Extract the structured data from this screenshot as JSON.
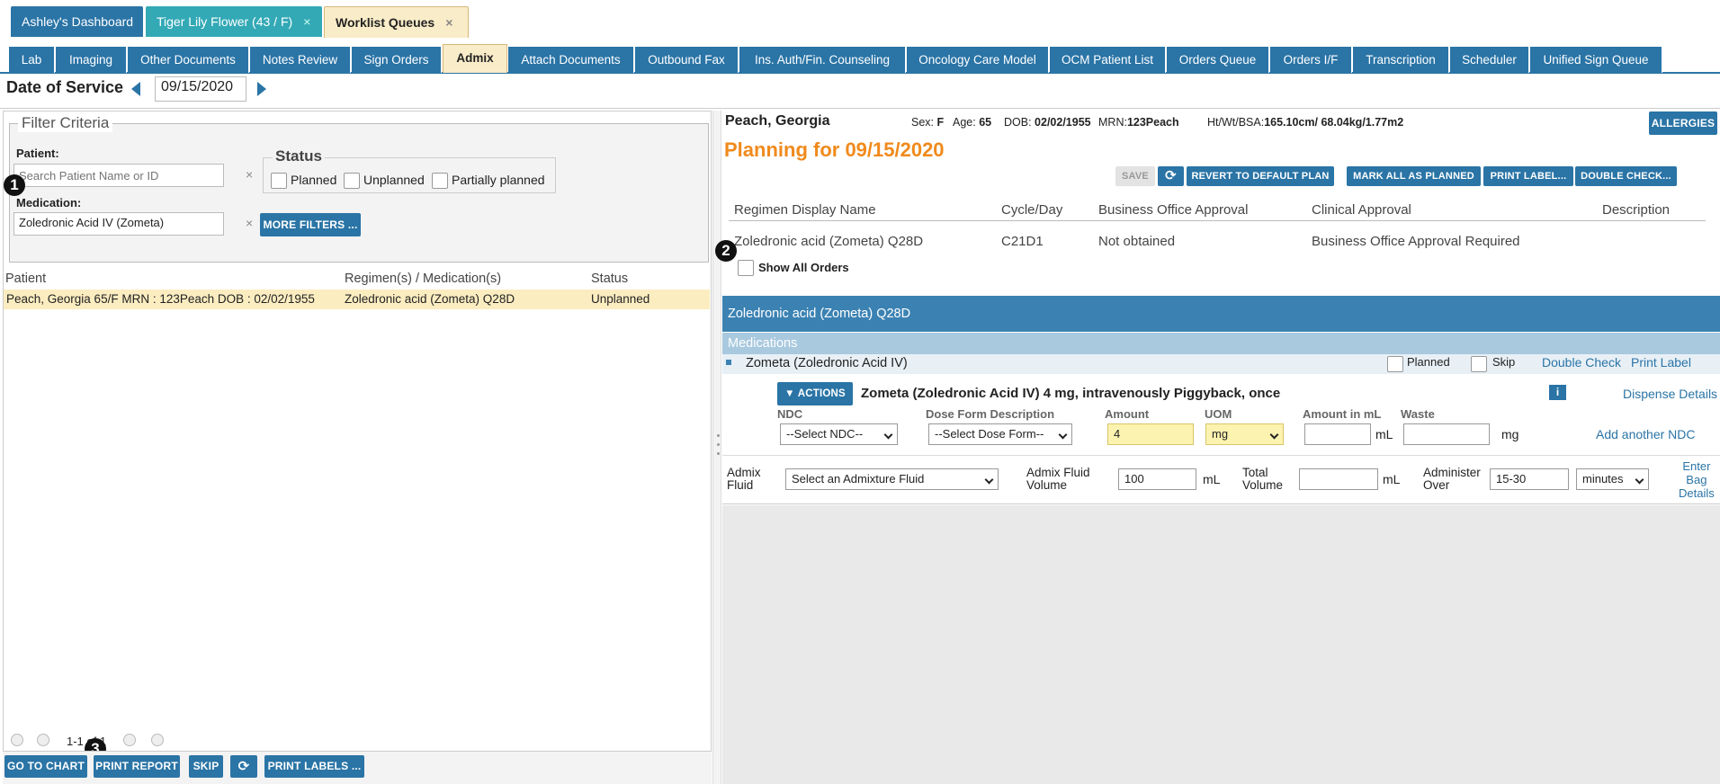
{
  "top_tabs": [
    {
      "label": "Ashley's Dashboard"
    },
    {
      "label": "Tiger Lily Flower (43 / F)",
      "close": "×"
    },
    {
      "label": "Worklist Queues",
      "close": "×"
    }
  ],
  "sub_tabs": [
    "Lab",
    "Imaging",
    "Other Documents",
    "Notes Review",
    "Sign Orders",
    "Admix",
    "Attach Documents",
    "Outbound Fax",
    "Ins. Auth/Fin. Counseling",
    "Oncology Care Model",
    "OCM Patient List",
    "Orders Queue",
    "Orders I/F",
    "Transcription",
    "Scheduler",
    "Unified Sign Queue"
  ],
  "date_of_service": {
    "label": "Date of Service",
    "value": "09/15/2020"
  },
  "filter": {
    "legend": "Filter Criteria",
    "patient_label": "Patient:",
    "patient_placeholder": "Search Patient Name or ID",
    "medication_label": "Medication:",
    "medication_value": "Zoledronic Acid IV (Zometa)",
    "clear": "×",
    "status_legend": "Status",
    "status_options": [
      "Planned",
      "Unplanned",
      "Partially planned"
    ],
    "more_filters": "MORE FILTERS ..."
  },
  "badges": [
    "1",
    "2",
    "3"
  ],
  "grid": {
    "headers": [
      "Patient",
      "Regimen(s) / Medication(s)",
      "Status"
    ],
    "rows": [
      {
        "patient": "Peach, Georgia 65/F MRN : 123Peach DOB : 02/02/1955",
        "regimen": "Zoledronic acid (Zometa) Q28D",
        "status": "Unplanned"
      }
    ],
    "pager": "1-1 of 1"
  },
  "bottom_buttons": [
    "GO TO CHART",
    "PRINT REPORT",
    "SKIP",
    "PRINT LABELS ..."
  ],
  "patient_header": {
    "name": "Peach, Georgia",
    "sex_label": "Sex:",
    "sex": "F",
    "age_label": "Age:",
    "age": "65",
    "dob_label": "DOB:",
    "dob": "02/02/1955",
    "mrn_label": "MRN:",
    "mrn": "123Peach",
    "hwbsa_label": "Ht/Wt/BSA:",
    "hwbsa": "165.10cm/ 68.04kg/1.77m2",
    "allergies": "ALLERGIES"
  },
  "planning_title": "Planning for 09/15/2020",
  "plan_buttons": {
    "save": "SAVE",
    "revert": "REVERT TO DEFAULT PLAN",
    "mark_all": "MARK ALL AS PLANNED",
    "print_label": "PRINT LABEL...",
    "double_check": "DOUBLE CHECK..."
  },
  "regimen_table": {
    "headers": [
      "Regimen Display Name",
      "Cycle/Day",
      "Business Office Approval",
      "Clinical Approval",
      "Description"
    ],
    "row": {
      "name": "Zoledronic acid (Zometa) Q28D",
      "cycle": "C21D1",
      "bo_approval": "Not obtained",
      "clinical": "Business Office Approval Required",
      "description": ""
    }
  },
  "show_all_orders": "Show All Orders",
  "regimen_band": "Zoledronic acid (Zometa) Q28D",
  "medications_band": "Medications",
  "drug": {
    "name": "Zometa (Zoledronic Acid IV)",
    "planned": "Planned",
    "skip": "Skip",
    "double_check": "Double Check",
    "print_label": "Print Label",
    "actions": "ACTIONS",
    "order_text": "Zometa (Zoledronic Acid IV) 4 mg, intravenously Piggyback, once",
    "info": "i",
    "dispense_details": "Dispense Details",
    "ndc_label": "NDC",
    "ndc_value": "--Select NDC--",
    "dose_form_label": "Dose Form Description",
    "dose_form_value": "--Select Dose Form--",
    "amount_label": "Amount",
    "amount_value": "4",
    "uom_label": "UOM",
    "uom_value": "mg",
    "amount_ml_label": "Amount in mL",
    "amount_ml_value": "",
    "ml_unit": "mL",
    "waste_label": "Waste",
    "waste_value": "",
    "waste_unit": "mg",
    "add_ndc": "Add another NDC"
  },
  "admix": {
    "fluid_label_1": "Admix",
    "fluid_label_2": "Fluid",
    "fluid_value": "Select an Admixture Fluid",
    "volume_label_1": "Admix Fluid",
    "volume_label_2": "Volume",
    "volume_value": "100",
    "volume_unit": "mL",
    "total_label_1": "Total",
    "total_label_2": "Volume",
    "total_value": "",
    "total_unit": "mL",
    "administer_label_1": "Administer",
    "administer_label_2": "Over",
    "administer_value": "15-30",
    "administer_unit": "minutes",
    "bag_1": "Enter",
    "bag_2": "Bag",
    "bag_3": "Details"
  }
}
